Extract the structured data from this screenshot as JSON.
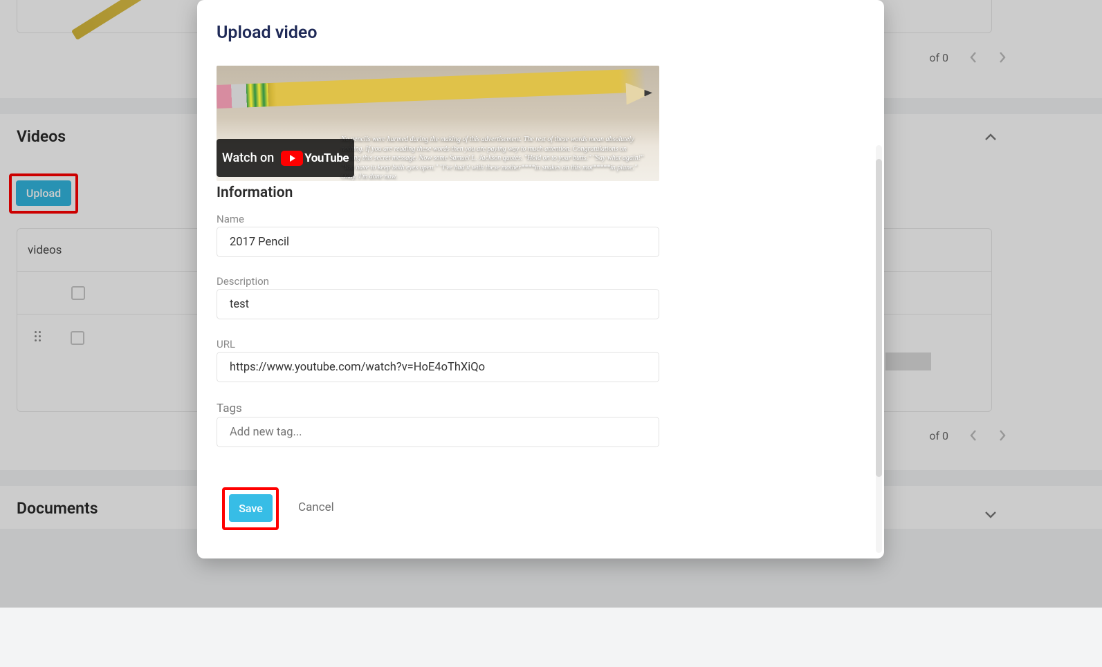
{
  "bg": {
    "videos_heading": "Videos",
    "upload_label": "Upload",
    "table_header": "videos",
    "documents_heading": "Documents",
    "pagination_text": "of 0"
  },
  "modal": {
    "title": "Upload video",
    "info_heading": "Information",
    "watch_label": "Watch on",
    "youtube_word": "YouTube",
    "preview_caption": "No pencils were harmed during the making of this advertisement. The rest of these words mean absolutely nothing. If you are reading these words then you are paying way to much attention. Congratulations on finding this secret message. Now some Samuel L. Jackson quotes. \"Hold on to your butts.\" \"Say what again!\" \"You have to keep both eyes open.\" \"I've had it with these mother****in snakes on this mot*****in plane.\" Okay. I'm done now.",
    "labels": {
      "name": "Name",
      "description": "Description",
      "url": "URL",
      "tags": "Tags"
    },
    "values": {
      "name": "2017 Pencil",
      "description": "test",
      "url": "https://www.youtube.com/watch?v=HoE4oThXiQo"
    },
    "placeholders": {
      "tags": "Add new tag..."
    },
    "buttons": {
      "save": "Save",
      "cancel": "Cancel"
    }
  }
}
